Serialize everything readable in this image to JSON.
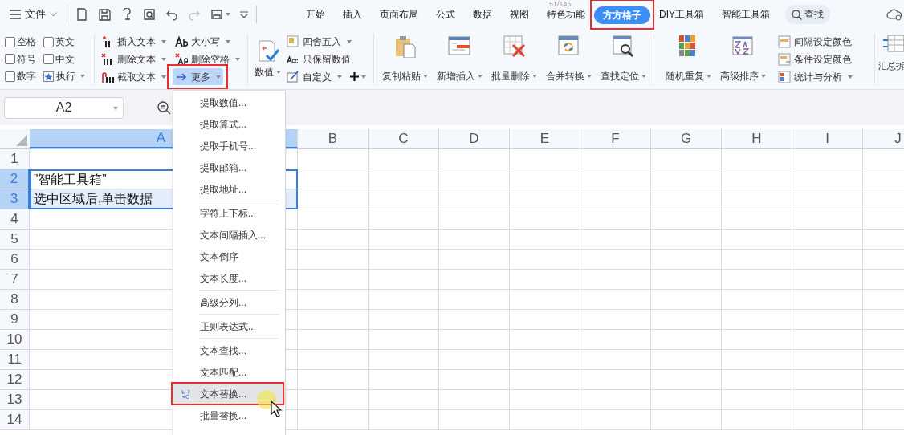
{
  "title_bar": {
    "file_menu": "文件",
    "counter": "51/145"
  },
  "tabs": [
    {
      "label": "开始",
      "selected": false
    },
    {
      "label": "插入",
      "selected": false
    },
    {
      "label": "页面布局",
      "selected": false
    },
    {
      "label": "公式",
      "selected": false
    },
    {
      "label": "数据",
      "selected": false
    },
    {
      "label": "视图",
      "selected": false
    },
    {
      "label": "特色功能",
      "selected": false
    },
    {
      "label": "方方格子",
      "selected": true
    },
    {
      "label": "DIY工具箱",
      "selected": false
    },
    {
      "label": "智能工具箱",
      "selected": false
    }
  ],
  "search": {
    "label": "查找"
  },
  "ribbon": {
    "checkboxes": [
      {
        "label": "空格",
        "checked": false
      },
      {
        "label": "英文",
        "checked": false
      },
      {
        "label": "符号",
        "checked": false
      },
      {
        "label": "中文",
        "checked": false
      },
      {
        "label": "数字",
        "checked": false
      }
    ],
    "run_button": "执行",
    "text_tools": [
      {
        "label": "插入文本",
        "kind": "insert",
        "selected": false
      },
      {
        "label": "大小写",
        "kind": "case",
        "selected": false
      },
      {
        "label": "删除文本",
        "kind": "delete",
        "selected": false
      },
      {
        "label": "删除空格",
        "kind": "space",
        "selected": false
      },
      {
        "label": "截取文本",
        "kind": "cut",
        "selected": false
      },
      {
        "label": "更多",
        "kind": "more",
        "selected": true
      }
    ],
    "number_button": "数值",
    "number_tools": [
      {
        "label": "四舍五入",
        "kind": "round",
        "dropdown": true
      },
      {
        "label": "只保留数值",
        "kind": "keep",
        "dropdown": false
      },
      {
        "label": "自定义",
        "kind": "custom",
        "dropdown": true
      }
    ],
    "big_buttons": [
      {
        "label": "复制粘贴",
        "kind": "clipboard"
      },
      {
        "label": "新增插入",
        "kind": "insert"
      },
      {
        "label": "批量删除",
        "kind": "delete"
      },
      {
        "label": "合并转换",
        "kind": "merge"
      },
      {
        "label": "查找定位",
        "kind": "find"
      },
      {
        "label": "随机重复",
        "kind": "random"
      },
      {
        "label": "高级排序",
        "kind": "sort"
      }
    ],
    "color_tools": [
      {
        "label": "间隔设定颜色",
        "dropdown": false
      },
      {
        "label": "条件设定颜色",
        "dropdown": false
      },
      {
        "label": "统计与分析",
        "dropdown": true
      }
    ],
    "last_button": "汇总拆"
  },
  "name_box": "A2",
  "sheet": {
    "columns": [
      "A",
      "B",
      "C",
      "D",
      "E",
      "F",
      "G",
      "H",
      "I",
      "J"
    ],
    "rows": [
      {
        "header": "1",
        "selected": false
      },
      {
        "header": "2",
        "selected": true,
        "a": "”智能工具箱”"
      },
      {
        "header": "3",
        "selected": true,
        "a": "选中区域后,单击数据"
      },
      {
        "header": "4",
        "selected": false
      },
      {
        "header": "5",
        "selected": false
      },
      {
        "header": "6",
        "selected": false
      },
      {
        "header": "7",
        "selected": false
      },
      {
        "header": "8",
        "selected": false
      },
      {
        "header": "9",
        "selected": false
      },
      {
        "header": "10",
        "selected": false
      },
      {
        "header": "11",
        "selected": false
      },
      {
        "header": "12",
        "selected": false
      },
      {
        "header": "13",
        "selected": false
      },
      {
        "header": "14",
        "selected": false
      }
    ]
  },
  "context_menu": {
    "items": [
      {
        "kind": "item",
        "label": "提取数值...",
        "selected": false
      },
      {
        "kind": "item",
        "label": "提取算式...",
        "selected": false
      },
      {
        "kind": "item",
        "label": "提取手机号...",
        "selected": false
      },
      {
        "kind": "item",
        "label": "提取邮箱...",
        "selected": false
      },
      {
        "kind": "item",
        "label": "提取地址...",
        "selected": false
      },
      {
        "kind": "separator"
      },
      {
        "kind": "item",
        "label": "字符上下标...",
        "selected": false
      },
      {
        "kind": "item",
        "label": "文本间隔插入...",
        "selected": false
      },
      {
        "kind": "item",
        "label": "文本倒序",
        "selected": false
      },
      {
        "kind": "item",
        "label": "文本长度...",
        "selected": false
      },
      {
        "kind": "separator"
      },
      {
        "kind": "item",
        "label": "高级分列...",
        "selected": false
      },
      {
        "kind": "separator"
      },
      {
        "kind": "item",
        "label": "正则表达式...",
        "selected": false
      },
      {
        "kind": "separator"
      },
      {
        "kind": "item",
        "label": "文本查找...",
        "selected": false
      },
      {
        "kind": "item",
        "label": "文本匹配...",
        "selected": false
      },
      {
        "kind": "item",
        "label": "文本替换...",
        "selected": true
      },
      {
        "kind": "item",
        "label": "批量替换...",
        "selected": false
      }
    ]
  }
}
